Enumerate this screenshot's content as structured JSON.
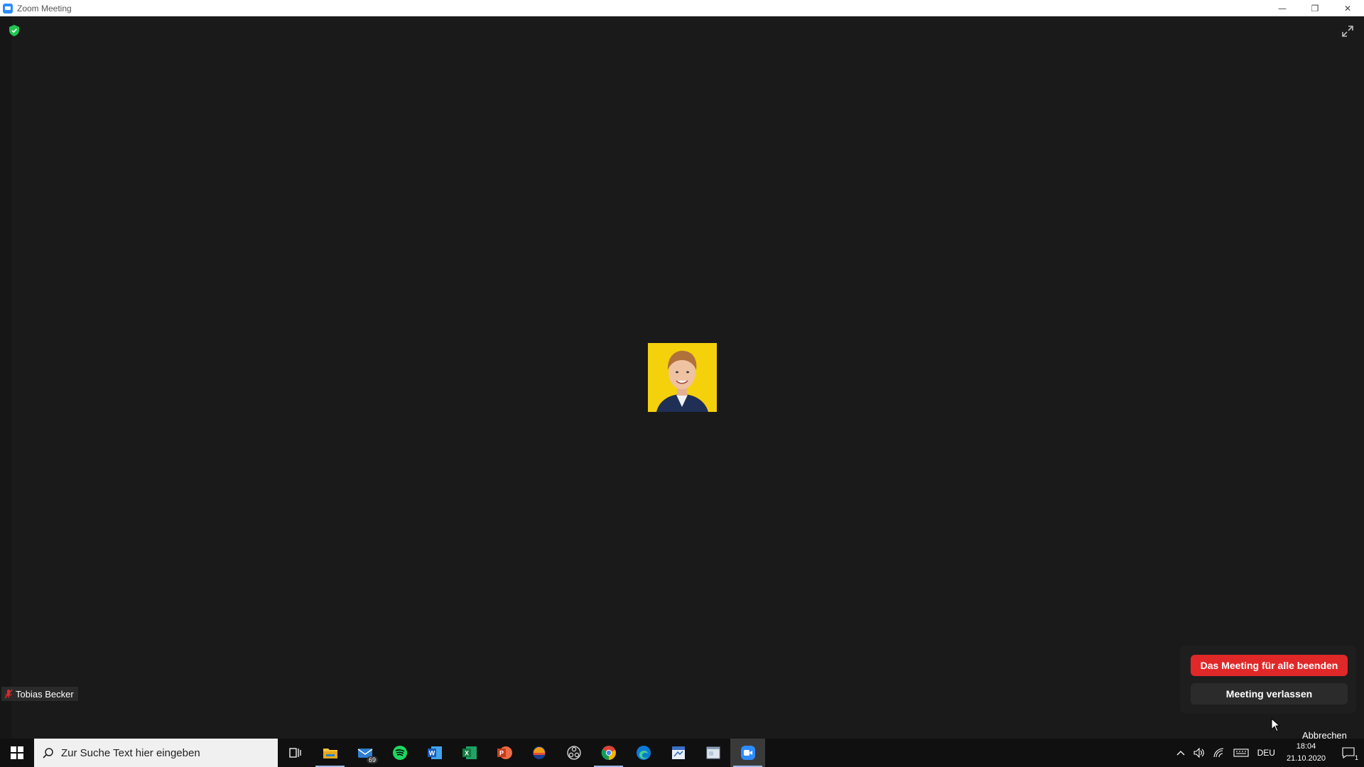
{
  "window": {
    "title": "Zoom Meeting",
    "controls": {
      "minimize": "—",
      "restore": "❐",
      "close": "✕"
    }
  },
  "meeting": {
    "participant_name": "Tobias Becker",
    "avatar_bg": "#f5d10c",
    "security_icon_color": "#23c552"
  },
  "leave_dialog": {
    "end_for_all_label": "Das Meeting für alle beenden",
    "leave_label": "Meeting verlassen",
    "cancel_label": "Abbrechen",
    "end_color": "#e02828"
  },
  "taskbar": {
    "search_placeholder": "Zur Suche Text hier eingeben",
    "mail_badge": "69",
    "apps": [
      "task-view",
      "file-explorer",
      "mail",
      "spotify",
      "word",
      "excel",
      "powerpoint",
      "app-orange",
      "obs",
      "chrome",
      "edge",
      "app-blue",
      "app-window",
      "zoom"
    ],
    "language": "DEU",
    "time": "18:04",
    "date": "21.10.2020",
    "notification_count": "1"
  }
}
